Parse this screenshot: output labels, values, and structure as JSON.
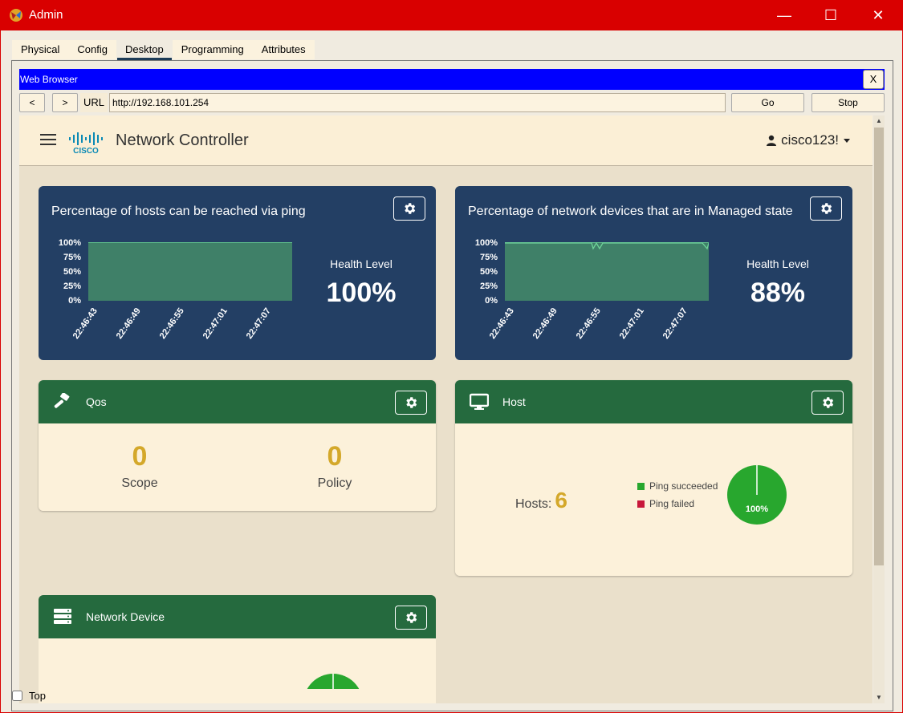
{
  "window": {
    "title": "Admin",
    "minimize": "—",
    "maximize": "☐",
    "close": "✕"
  },
  "tabs": [
    {
      "label": "Physical"
    },
    {
      "label": "Config"
    },
    {
      "label": "Desktop"
    },
    {
      "label": "Programming"
    },
    {
      "label": "Attributes"
    }
  ],
  "browser": {
    "title": "Web Browser",
    "close_label": "X",
    "back_label": "<",
    "forward_label": ">",
    "url_label": "URL",
    "url": "http://192.168.101.254",
    "go_label": "Go",
    "stop_label": "Stop"
  },
  "app": {
    "logo_text": "CISCO",
    "brand": "Network Controller",
    "user": "cisco123!"
  },
  "ping_card": {
    "title": "Percentage of hosts can be reached via ping",
    "health_label": "Health Level",
    "health_value": "100%",
    "y_ticks": [
      "100%",
      "75%",
      "50%",
      "25%",
      "0%"
    ],
    "x_ticks": [
      "22:46:43",
      "22:46:49",
      "22:46:55",
      "22:47:01",
      "22:47:07"
    ]
  },
  "managed_card": {
    "title": "Percentage of network devices that are in Managed state",
    "health_label": "Health Level",
    "health_value": "88%",
    "y_ticks": [
      "100%",
      "75%",
      "50%",
      "25%",
      "0%"
    ],
    "x_ticks": [
      "22:46:43",
      "22:46:49",
      "22:46:55",
      "22:47:01",
      "22:47:07"
    ]
  },
  "qos_card": {
    "title": "Qos",
    "scope_value": "0",
    "scope_label": "Scope",
    "policy_value": "0",
    "policy_label": "Policy"
  },
  "host_card": {
    "title": "Host",
    "hosts_label": "Hosts:",
    "hosts_value": "6",
    "legend_success": "Ping succeeded",
    "legend_failed": "Ping failed",
    "pie_label": "100%",
    "colors": {
      "success": "#28a72e",
      "failed": "#c8183a"
    }
  },
  "network_device_card": {
    "title": "Network Device"
  },
  "footer": {
    "top_label": "Top"
  }
}
